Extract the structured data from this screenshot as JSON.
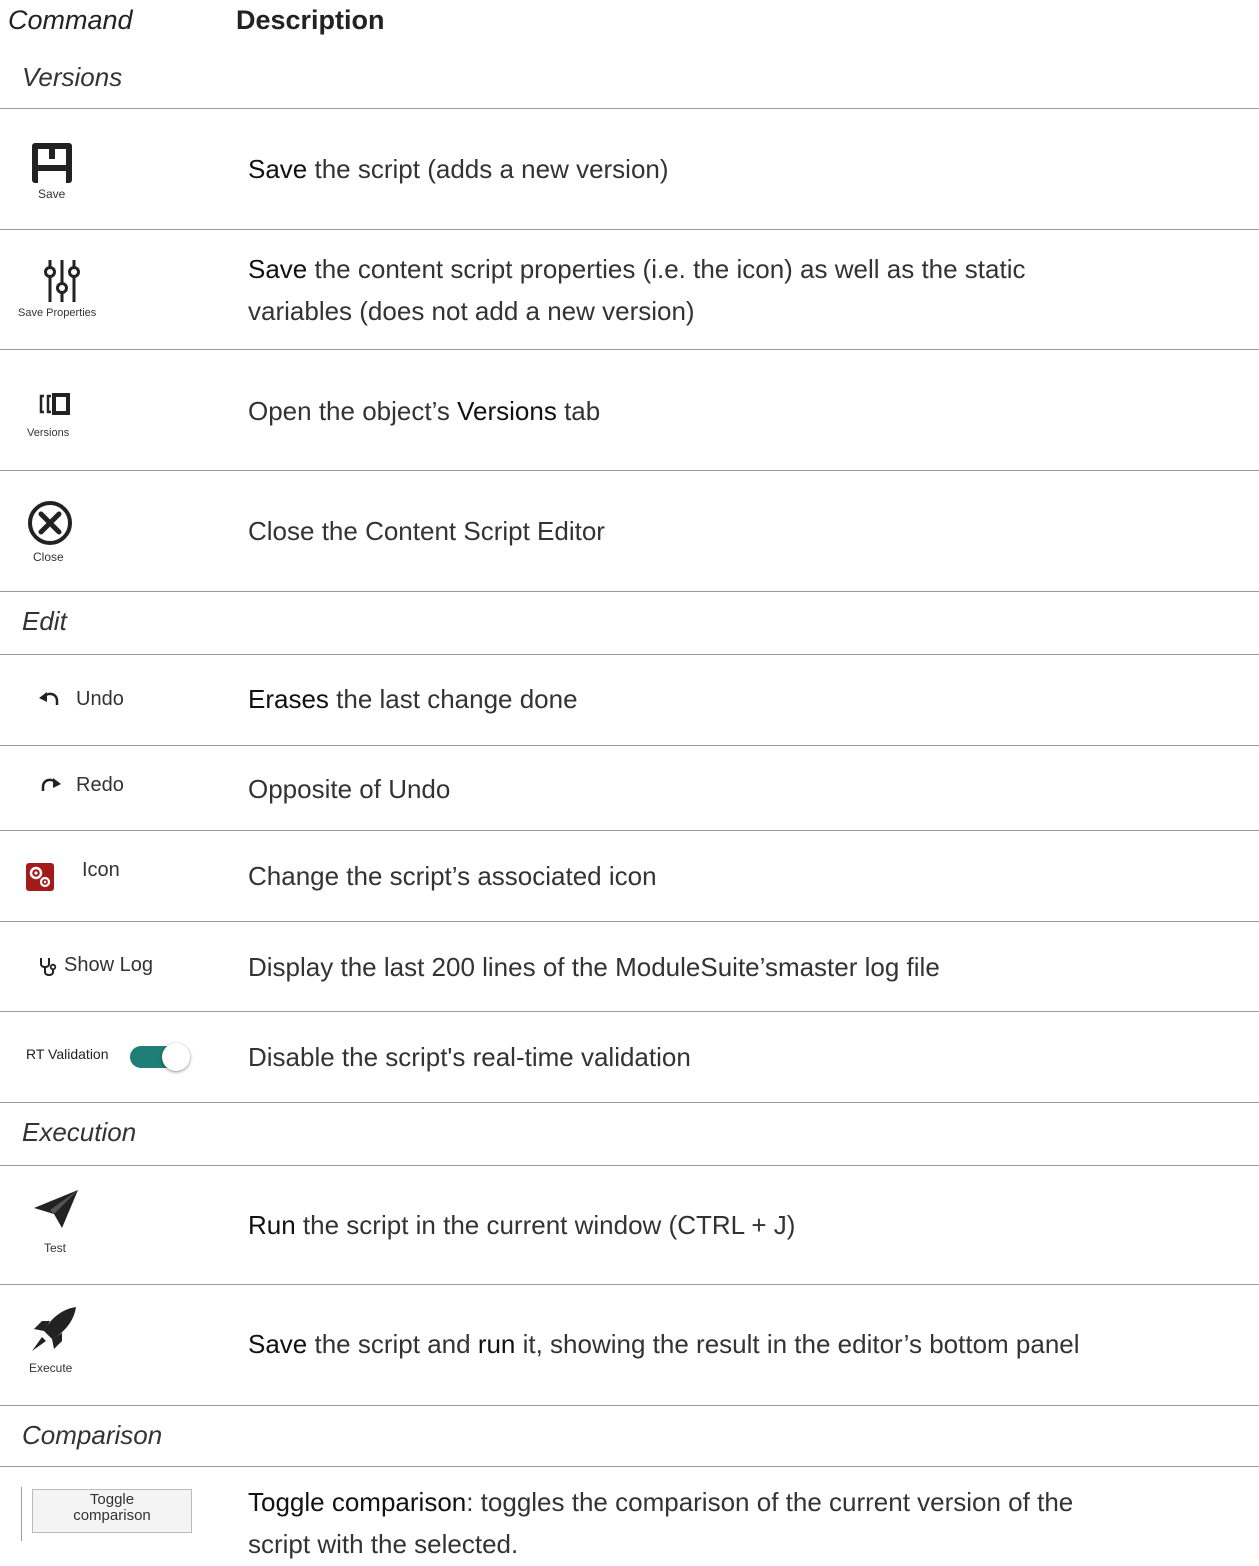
{
  "header": {
    "command": "Command",
    "description": "Description"
  },
  "sections": {
    "versions": "Versions",
    "edit": "Edit",
    "execution": "Execution",
    "comparison": "Comparison"
  },
  "rows": {
    "save": {
      "icon_label": "Save",
      "icon": "floppy-disk-icon",
      "kw": "Save",
      "rest": " the script (adds a new version)"
    },
    "save_properties": {
      "icon_label": "Save Properties",
      "icon": "sliders-icon",
      "kw": "Save",
      "rest": " the content script properties (i.e. the icon) as well as the static",
      "rest2": "variables (does not add a new version)"
    },
    "versions": {
      "icon_label": "Versions",
      "icon": "versions-icon",
      "pre": "Open the object’s ",
      "kw": "Versions",
      "rest": " tab"
    },
    "close": {
      "icon_label": "Close",
      "icon": "close-circle-icon",
      "text": "Close the Content Script Editor"
    },
    "undo": {
      "icon_label": "Undo",
      "icon": "undo-icon",
      "kw": "Erases",
      "rest": " the last change done"
    },
    "redo": {
      "icon_label": "Redo",
      "icon": "redo-icon",
      "text": "Opposite of Undo"
    },
    "icon": {
      "icon_label": "Icon",
      "icon": "gears-icon",
      "text": "Change the script’s associated icon"
    },
    "show_log": {
      "icon_label": "Show Log",
      "icon": "stethoscope-icon",
      "text": "Display the last 200 lines of the ModuleSuite’smaster log file"
    },
    "rt_validation": {
      "icon_label": "RT Validation",
      "toggle_state": "on",
      "text": "Disable the script's real-time validation"
    },
    "test": {
      "icon_label": "Test",
      "icon": "paper-plane-icon",
      "kw": "Run",
      "rest": " the script in the current window (CTRL + J)"
    },
    "execute": {
      "icon_label": "Execute",
      "icon": "rocket-icon",
      "kw": "Save",
      "mid": " the script and ",
      "kw2": "run",
      "rest": " it, showing the result in the editor’s bottom panel"
    },
    "toggle_comparison": {
      "button_line1": "Toggle",
      "button_line2": "comparison",
      "kw": "Toggle comparison",
      "rest": ": toggles the comparison of the current version of the",
      "rest2": "script with the selected."
    }
  },
  "colors": {
    "toggle_on": "#1f7e78",
    "icon_red": "#a31a1a",
    "divider": "#9a9a9a"
  }
}
